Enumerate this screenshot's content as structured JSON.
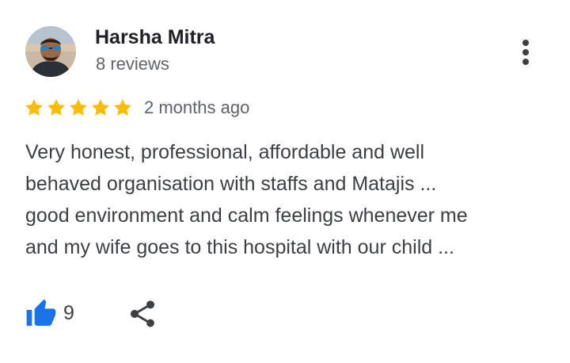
{
  "review": {
    "author": {
      "name": "Harsha Mitra",
      "reviews_count": "8 reviews",
      "avatar_icon": "profile-photo"
    },
    "rating": {
      "stars": 5,
      "max_stars": 5,
      "time_ago": "2 months ago"
    },
    "text_lines": [
      "Very honest, professional, affordable and well",
      "behaved organisation with staffs and Matajis ...",
      "good environment and calm feelings whenever me",
      "and my wife goes to this hospital with our child ..."
    ],
    "actions": {
      "like_icon": "thumbs-up-icon",
      "like_count": "9",
      "share_icon": "share-icon",
      "more_icon": "more-vert-icon"
    }
  },
  "colors": {
    "star": "#fbbc04",
    "like": "#1a73e8",
    "text": "#3c4043",
    "secondary": "#5f6368"
  }
}
